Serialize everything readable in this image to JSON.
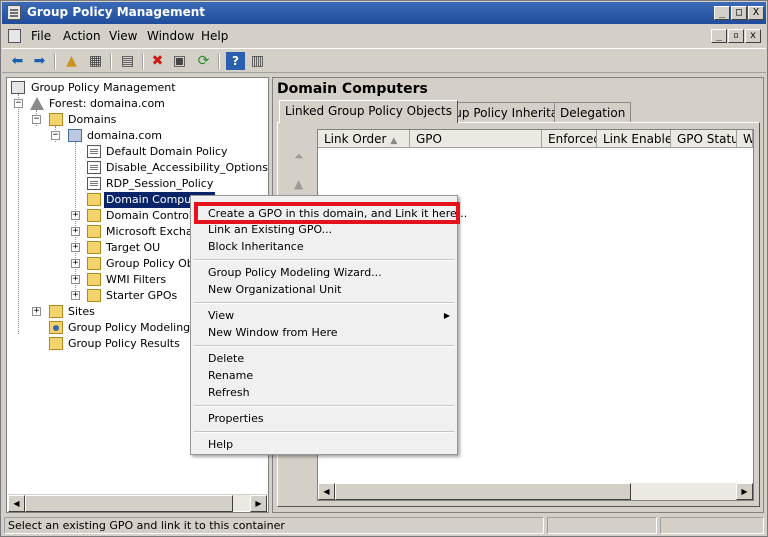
{
  "window": {
    "title": "Group Policy Management",
    "minimize": "_",
    "maximize": "□",
    "close": "X"
  },
  "menubar": {
    "items": [
      "File",
      "Action",
      "View",
      "Window",
      "Help"
    ]
  },
  "toolbar": {
    "icons": [
      "back-arrow-icon",
      "forward-arrow-icon",
      "up-folder-icon",
      "show-hide-tree-icon",
      "properties-icon",
      "delete-icon",
      "export-icon",
      "refresh-icon",
      "help-icon",
      "show-action-pane-icon"
    ]
  },
  "tree": {
    "root": "Group Policy Management",
    "forest": "Forest: domaina.com",
    "domains": "Domains",
    "domain": "domaina.com",
    "items": {
      "default_domain_policy": "Default Domain Policy",
      "disable_accessibility": "Disable_Accessibility_Options",
      "rdp_session_policy": "RDP_Session_Policy",
      "domain_computers": "Domain Computers",
      "domain_controllers": "Domain Controllers",
      "microsoft_exchange": "Microsoft Exchange",
      "target_ou": "Target OU",
      "group_policy_objects": "Group Policy Objects",
      "wmi_filters": "WMI Filters",
      "starter_gpos": "Starter GPOs"
    },
    "sites": "Sites",
    "modeling": "Group Policy Modeling",
    "results": "Group Policy Results"
  },
  "right_pane": {
    "heading": "Domain Computers",
    "tabs": [
      "Linked Group Policy Objects",
      "Group Policy Inheritance",
      "Delegation"
    ],
    "columns": [
      "Link Order",
      "GPO",
      "Enforced",
      "Link Enabled",
      "GPO Status",
      "W"
    ]
  },
  "context_menu": {
    "items": [
      "Create a GPO in this domain, and Link it here...",
      "Link an Existing GPO...",
      "Block Inheritance",
      "Group Policy Modeling Wizard...",
      "New Organizational Unit",
      "View",
      "New Window from Here",
      "Delete",
      "Rename",
      "Refresh",
      "Properties",
      "Help"
    ],
    "highlight_color": "#e5121d"
  },
  "statusbar": {
    "text": "Select an existing GPO and link it to this container"
  }
}
